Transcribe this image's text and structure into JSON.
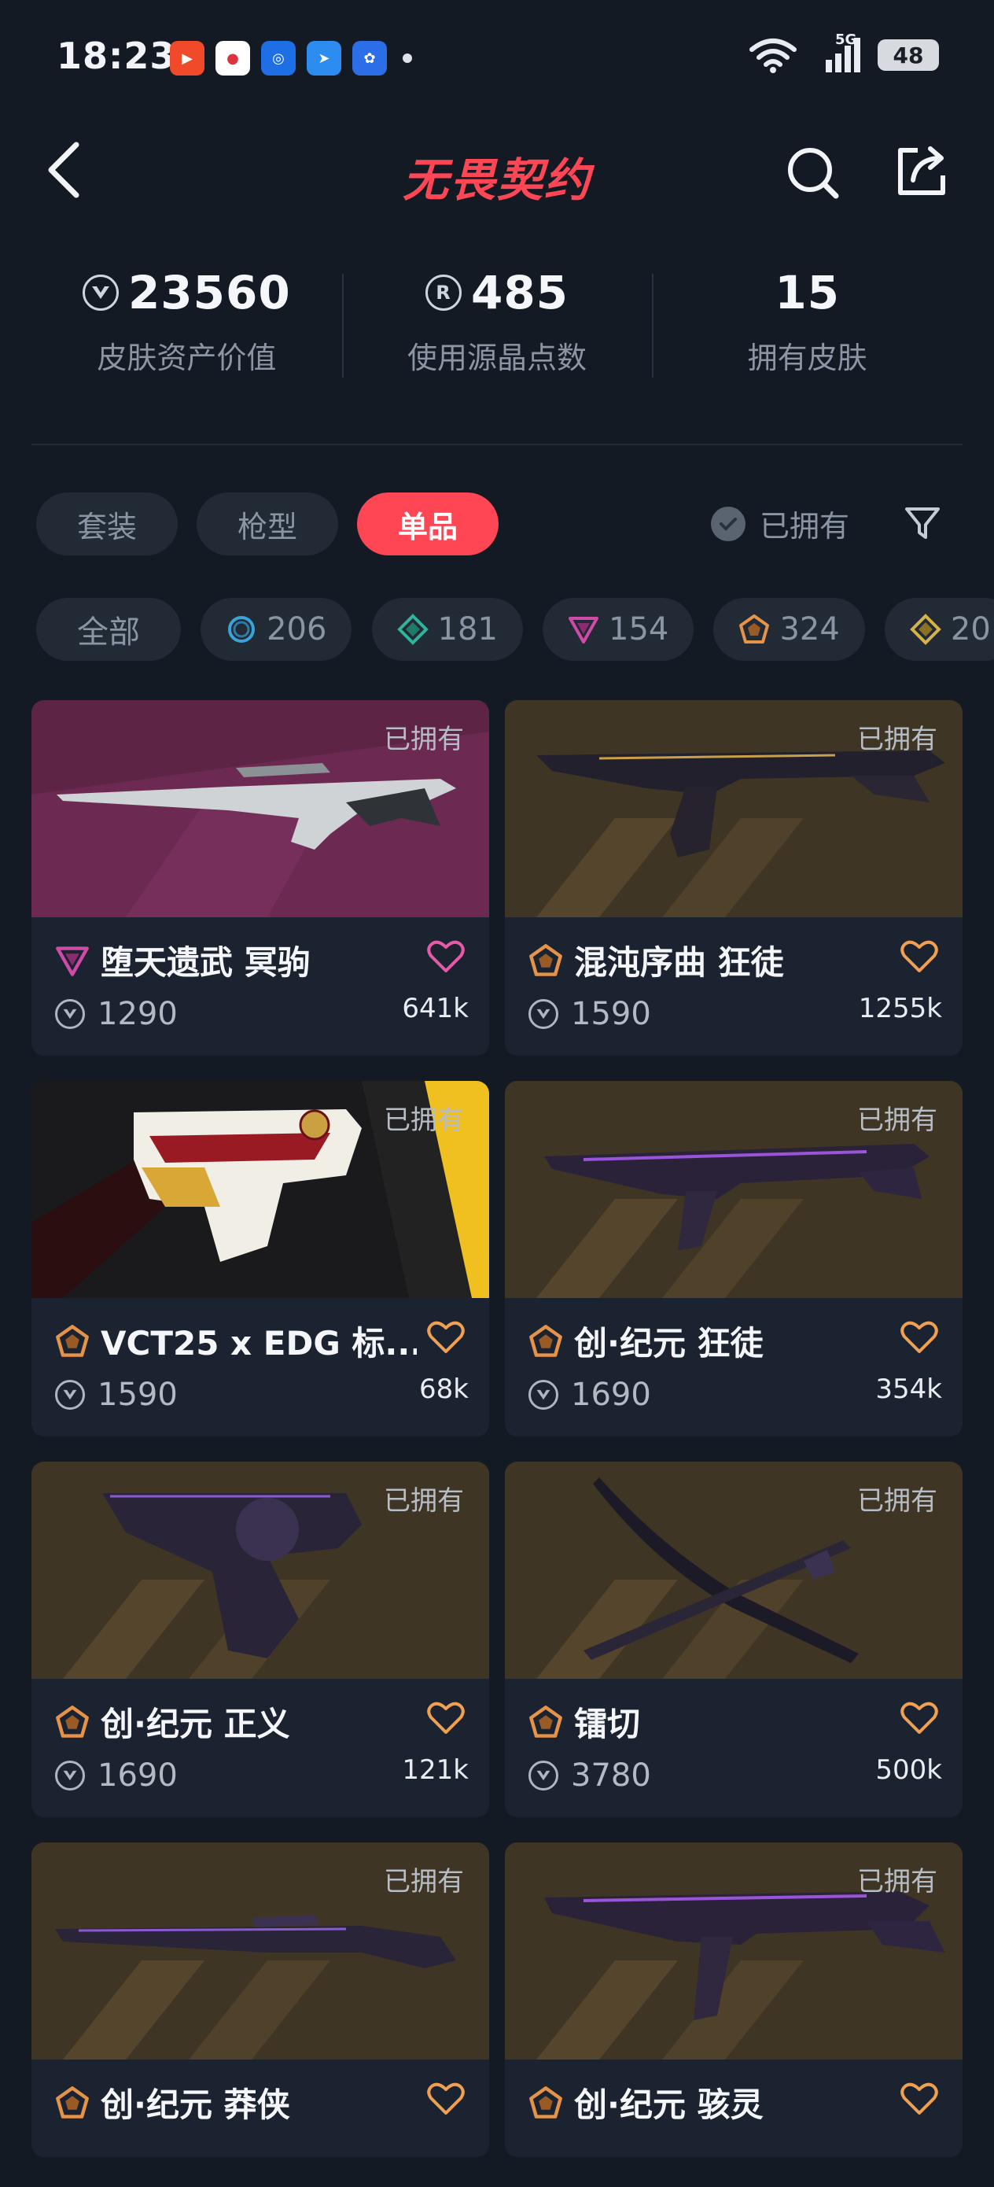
{
  "status_bar": {
    "time": "18:23",
    "battery": "48",
    "network": "5G"
  },
  "header": {
    "logo": "无畏契约"
  },
  "stats": [
    {
      "value": "23560",
      "label": "皮肤资产价值",
      "icon": "vp-currency-icon"
    },
    {
      "value": "485",
      "label": "使用源晶点数",
      "icon": "radianite-icon"
    },
    {
      "value": "15",
      "label": "拥有皮肤",
      "icon": ""
    }
  ],
  "filters": {
    "tabs": [
      "套装",
      "枪型",
      "单品"
    ],
    "active_tab": "单品",
    "owned_label": "已拥有"
  },
  "rarity": [
    {
      "label": "全部",
      "count": ""
    },
    {
      "label": "",
      "count": "206",
      "tier": "select"
    },
    {
      "label": "",
      "count": "181",
      "tier": "deluxe"
    },
    {
      "label": "",
      "count": "154",
      "tier": "exclusive"
    },
    {
      "label": "",
      "count": "324",
      "tier": "ultra"
    },
    {
      "label": "",
      "count": "20",
      "tier": "premium"
    }
  ],
  "colors": {
    "accent": "#ff4655",
    "background": "#141a24",
    "card": "#1c2330"
  },
  "skins": [
    {
      "name": "堕天遗武 冥驹",
      "price": "1290",
      "likes": "641k",
      "owned": "已拥有",
      "tier": "exclusive"
    },
    {
      "name": "混沌序曲 狂徒",
      "price": "1590",
      "likes": "1255k",
      "owned": "已拥有",
      "tier": "ultra"
    },
    {
      "name": "VCT25 x EDG 标...",
      "price": "1590",
      "likes": "68k",
      "owned": "已拥有",
      "tier": "ultra"
    },
    {
      "name": "创·纪元 狂徒",
      "price": "1690",
      "likes": "354k",
      "owned": "已拥有",
      "tier": "ultra"
    },
    {
      "name": "创·纪元 正义",
      "price": "1690",
      "likes": "121k",
      "owned": "已拥有",
      "tier": "ultra"
    },
    {
      "name": "镭切",
      "price": "3780",
      "likes": "500k",
      "owned": "已拥有",
      "tier": "ultra"
    },
    {
      "name": "创·纪元 莽侠",
      "price": "",
      "likes": "",
      "owned": "已拥有",
      "tier": "ultra"
    },
    {
      "name": "创·纪元 骇灵",
      "price": "",
      "likes": "",
      "owned": "已拥有",
      "tier": "ultra"
    }
  ]
}
